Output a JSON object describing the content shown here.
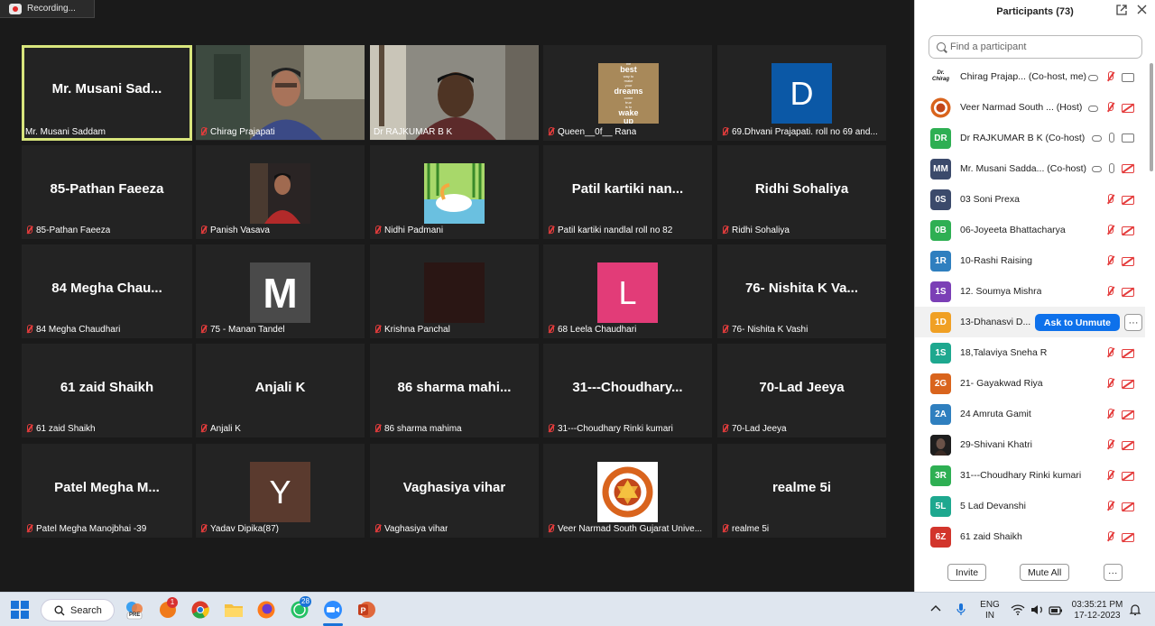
{
  "recording": {
    "label": "Recording..."
  },
  "tiles": [
    {
      "name": "Mr. Musani Sad...",
      "label": "Mr. Musani Saddam",
      "muted": false,
      "kind": "name",
      "active": true
    },
    {
      "name": "",
      "label": "Chirag Prajapati",
      "muted": true,
      "kind": "video1"
    },
    {
      "name": "",
      "label": "Dr RAJKUMAR B K",
      "muted": false,
      "kind": "video2"
    },
    {
      "name": "",
      "label": "Queen__0f__ Rana",
      "muted": true,
      "kind": "picture-book"
    },
    {
      "name": "",
      "label": "69.Dhvani Prajapati. roll no 69 and...",
      "muted": true,
      "kind": "avatar",
      "letter": "D",
      "color": "#0b58a6"
    },
    {
      "name": "85-Pathan Faeeza",
      "label": "85-Pathan Faeeza",
      "muted": true,
      "kind": "name"
    },
    {
      "name": "",
      "label": "Panish Vasava",
      "muted": true,
      "kind": "picture-person"
    },
    {
      "name": "",
      "label": "Nidhi Padmani",
      "muted": true,
      "kind": "picture-bird"
    },
    {
      "name": "Patil kartiki nan...",
      "label": "Patil kartiki nandlal roll no 82",
      "muted": true,
      "kind": "name"
    },
    {
      "name": "Ridhi Sohaliya",
      "label": "Ridhi Sohaliya",
      "muted": true,
      "kind": "name"
    },
    {
      "name": "84 Megha Chau...",
      "label": "84 Megha Chaudhari",
      "muted": true,
      "kind": "name"
    },
    {
      "name": "",
      "label": "75 - Manan Tandel",
      "muted": true,
      "kind": "avatar",
      "letter": "M",
      "color": "#4a4a4a",
      "bold": true
    },
    {
      "name": "",
      "label": "Krishna Panchal",
      "muted": true,
      "kind": "avatar",
      "letter": "",
      "color": "#2a1614"
    },
    {
      "name": "",
      "label": "68 Leela Chaudhari",
      "muted": true,
      "kind": "avatar",
      "letter": "L",
      "color": "#e23c78"
    },
    {
      "name": "76- Nishita K Va...",
      "label": "76- Nishita K Vashi",
      "muted": true,
      "kind": "name"
    },
    {
      "name": "61 zaid Shaikh",
      "label": "61 zaid Shaikh",
      "muted": true,
      "kind": "name"
    },
    {
      "name": "Anjali K",
      "label": "Anjali K",
      "muted": true,
      "kind": "name"
    },
    {
      "name": "86 sharma mahi...",
      "label": "86 sharma mahima",
      "muted": true,
      "kind": "name"
    },
    {
      "name": "31---Choudhary...",
      "label": "31---Choudhary Rinki kumari",
      "muted": true,
      "kind": "name"
    },
    {
      "name": "70-Lad Jeeya",
      "label": "70-Lad Jeeya",
      "muted": true,
      "kind": "name"
    },
    {
      "name": "Patel Megha M...",
      "label": "Patel Megha Manojbhai -39",
      "muted": true,
      "kind": "name"
    },
    {
      "name": "",
      "label": "Yadav Dipika(87)",
      "muted": true,
      "kind": "avatar",
      "letter": "Y",
      "color": "#5a3a2e"
    },
    {
      "name": "Vaghasiya vihar",
      "label": "Vaghasiya vihar",
      "muted": true,
      "kind": "name"
    },
    {
      "name": "",
      "label": "Veer Narmad South Gujarat Unive...",
      "muted": true,
      "kind": "picture-logo"
    },
    {
      "name": "realme 5i",
      "label": "realme 5i",
      "muted": true,
      "kind": "name"
    }
  ],
  "tile_picture_text": {
    "book": [
      "the",
      "best",
      "way to",
      "make",
      "your",
      "dreams",
      "come",
      "true",
      "is to",
      "wake",
      "up"
    ]
  },
  "panel": {
    "title": "Participants (73)",
    "search_placeholder": "Find a participant",
    "ask_to_unmute": "Ask to Unmute",
    "more": "···",
    "invite": "Invite",
    "mute_all": "Mute All",
    "footer_more": "···"
  },
  "participants": [
    {
      "initials": "Dr. Chirag",
      "name": "Chirag Prajap... (Co-host, me)",
      "color": "#ffffff",
      "status": "host-muted",
      "logoAvatar": "text"
    },
    {
      "initials": "",
      "name": "Veer Narmad South ... (Host)",
      "color": "#d9641d",
      "status": "host-muted",
      "logoAvatar": "logo"
    },
    {
      "initials": "DR",
      "name": "Dr RAJKUMAR B K (Co-host)",
      "color": "#2eaf53",
      "status": "live"
    },
    {
      "initials": "MM",
      "name": "Mr. Musani Sadda... (Co-host)",
      "color": "#3b4a6b",
      "status": "cohost-mic"
    },
    {
      "initials": "0S",
      "name": "03 Soni Prexa",
      "color": "#3b4a6b",
      "status": "muted"
    },
    {
      "initials": "0B",
      "name": "06-Joyeeta Bhattacharya",
      "color": "#2eaf53",
      "status": "muted"
    },
    {
      "initials": "1R",
      "name": "10-Rashi Raising",
      "color": "#2f7fbf",
      "status": "muted"
    },
    {
      "initials": "1S",
      "name": "12. Soumya Mishra",
      "color": "#7b3fb6",
      "status": "muted"
    },
    {
      "initials": "1D",
      "name": "13-Dhanasvi D...",
      "color": "#f0a024",
      "status": "ask",
      "highlight": true
    },
    {
      "initials": "1S",
      "name": "18,Talaviya Sneha R",
      "color": "#1ea88f",
      "status": "muted"
    },
    {
      "initials": "2G",
      "name": "21- Gayakwad Riya",
      "color": "#d9641d",
      "status": "muted"
    },
    {
      "initials": "2A",
      "name": "24 Amruta Gamit",
      "color": "#2f7fbf",
      "status": "muted"
    },
    {
      "initials": "",
      "name": "29-Shivani Khatri",
      "color": "#222222",
      "status": "muted",
      "logoAvatar": "photo"
    },
    {
      "initials": "3R",
      "name": "31---Choudhary Rinki kumari",
      "color": "#2eaf53",
      "status": "muted"
    },
    {
      "initials": "5L",
      "name": "5 Lad Devanshi",
      "color": "#1ea88f",
      "status": "muted"
    },
    {
      "initials": "6Z",
      "name": "61 zaid Shaikh",
      "color": "#d2352c",
      "status": "muted"
    }
  ],
  "taskbar": {
    "search_label": "Search",
    "lang_top": "ENG",
    "lang_bottom": "IN",
    "time": "03:35:21 PM",
    "date": "17-12-2023",
    "badge_firefox": "1",
    "badge_whatsapp": "28",
    "pre_label": "PRE"
  },
  "colors": {
    "active_tile_border": "#d8e57c",
    "zoom_blue": "#0e71eb",
    "muted_red": "#e43c3c"
  }
}
